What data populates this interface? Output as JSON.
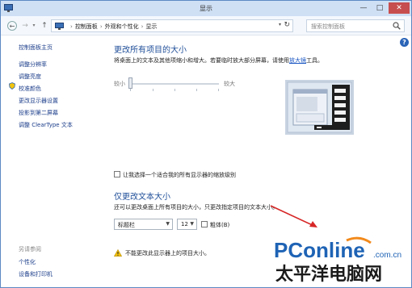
{
  "window": {
    "title": "显示"
  },
  "controls": {
    "minimize": "—",
    "maximize": "□",
    "close": "✕"
  },
  "address": {
    "path": [
      "控制面板",
      "外观和个性化",
      "显示"
    ],
    "search_placeholder": "搜索控制面板"
  },
  "help": {
    "label": "?"
  },
  "leftnav": {
    "home": "控制面板主页",
    "items": [
      {
        "label": "调整分辨率"
      },
      {
        "label": "调整亮度"
      },
      {
        "label": "校准颜色"
      },
      {
        "label": "更改显示器设置"
      },
      {
        "label": "投影到第二屏幕"
      },
      {
        "label": "调整 ClearType 文本"
      }
    ],
    "see_also_title": "另请参阅",
    "see_also": [
      {
        "label": "个性化"
      },
      {
        "label": "设备和打印机"
      }
    ]
  },
  "section_size": {
    "heading": "更改所有项目的大小",
    "description_prefix": "将桌面上的文本及其他项缩小和增大。若要临时放大部分屏幕，请使用",
    "description_link": "放大镜",
    "description_suffix": "工具。",
    "slider_small": "较小",
    "slider_large": "较大",
    "slider_position": 0,
    "custom_scaling_label": "让我选择一个适合我的所有显示器的缩放级别",
    "custom_scaling_checked": false
  },
  "section_text": {
    "heading": "仅更改文本大小",
    "description": "还可以更改桌面上所有项目的大小，只更改指定项目的文本大小。",
    "item_select": "标题栏",
    "size_select": "12",
    "bold_label": "粗体(B)",
    "bold_checked": false
  },
  "warning": {
    "text": "不能更改此显示器上的项目大小。"
  },
  "watermark": {
    "brand": "PConline",
    "domain": ".com.cn",
    "tagline": "太平洋电脑网"
  },
  "colors": {
    "heading": "#1f4e99",
    "link": "#1b3d8a",
    "close_button": "#c74e4e",
    "brand_blue": "#1e63b5",
    "brand_orange": "#f28a1c"
  }
}
